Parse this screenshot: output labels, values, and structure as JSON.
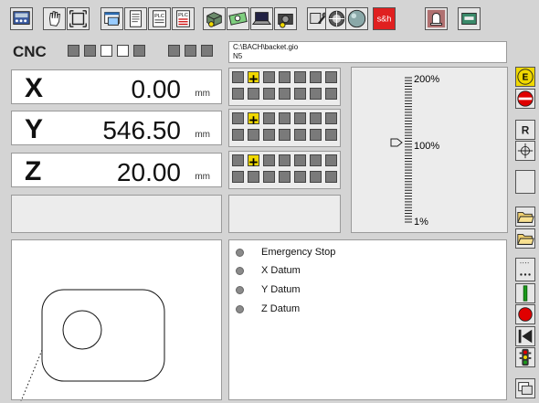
{
  "toolbar": {
    "buttons": [
      {
        "icon": "control-panel-icon"
      },
      {
        "icon": "hand-jog-icon"
      },
      {
        "icon": "frame-icon"
      },
      {
        "icon": "window-icon"
      },
      {
        "icon": "document-icon"
      },
      {
        "icon": "plc-icon",
        "label": "PLC"
      },
      {
        "icon": "plc-list-icon",
        "label": "PLC"
      },
      {
        "icon": "machine-3d-icon"
      },
      {
        "icon": "money-icon"
      },
      {
        "icon": "laptop-icon"
      },
      {
        "icon": "camera-icon"
      },
      {
        "icon": "tools-icon"
      },
      {
        "icon": "color-wheel-icon"
      },
      {
        "icon": "sphere-icon"
      },
      {
        "icon": "sh-logo-icon",
        "label": "s&h"
      },
      {
        "icon": "bell-icon"
      },
      {
        "icon": "card-icon"
      }
    ]
  },
  "cnc": {
    "label": "CNC",
    "file_path": "C:\\BACH\\backet.gio",
    "block": "N5"
  },
  "axes": [
    {
      "name": "X",
      "value": "0.00",
      "unit": "mm"
    },
    {
      "name": "Y",
      "value": "546.50",
      "unit": "mm"
    },
    {
      "name": "Z",
      "value": "20.00",
      "unit": "mm"
    }
  ],
  "override": {
    "labels": [
      "200%",
      "100%",
      "1%"
    ],
    "value_percent": 110
  },
  "messages": [
    "Emergency Stop",
    "X Datum",
    "Y Datum",
    "Z Datum"
  ],
  "side_buttons": {
    "e_label": "E",
    "r_label": "R"
  },
  "colors": {
    "background": "#d4d4d4",
    "highlight": "#f0d800",
    "stop_red": "#e00000",
    "green": "#1a9a1a"
  }
}
